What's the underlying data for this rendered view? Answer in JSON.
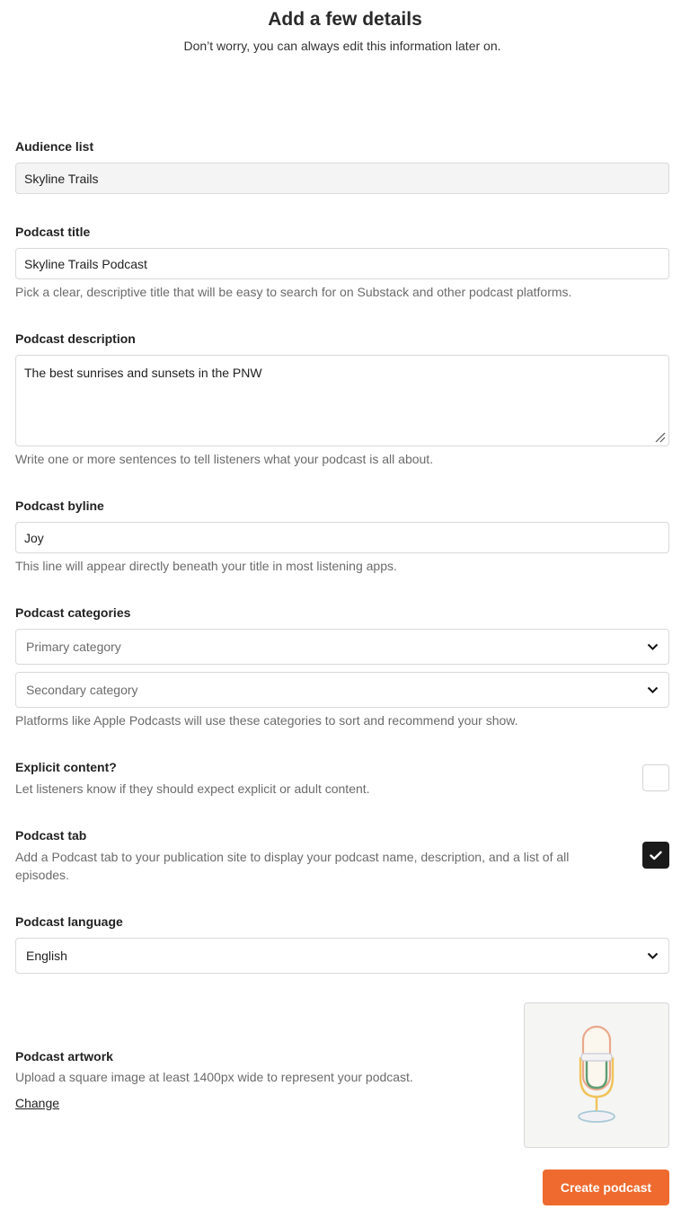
{
  "header": {
    "title": "Add a few details",
    "subtitle": "Don’t worry, you can always edit this information later on."
  },
  "audience": {
    "label": "Audience list",
    "value": "Skyline Trails"
  },
  "title_field": {
    "label": "Podcast title",
    "value": "Skyline Trails Podcast",
    "help": "Pick a clear, descriptive title that will be easy to search for on Substack and other podcast platforms."
  },
  "description": {
    "label": "Podcast description",
    "value": "The best sunrises and sunsets in the PNW",
    "help": "Write one or more sentences to tell listeners what your podcast is all about."
  },
  "byline": {
    "label": "Podcast byline",
    "value": "Joy",
    "help": "This line will appear directly beneath your title in most listening apps."
  },
  "categories": {
    "label": "Podcast categories",
    "primary_placeholder": "Primary category",
    "secondary_placeholder": "Secondary category",
    "help": "Platforms like Apple Podcasts will use these categories to sort and recommend your show."
  },
  "explicit": {
    "label": "Explicit content?",
    "help": "Let listeners know if they should expect explicit or adult content.",
    "checked": false
  },
  "podcast_tab": {
    "label": "Podcast tab",
    "help": "Add a Podcast tab to your publication site to display your podcast name, description, and a list of all episodes.",
    "checked": true
  },
  "language": {
    "label": "Podcast language",
    "value": "English"
  },
  "artwork": {
    "label": "Podcast artwork",
    "help": "Upload a square image at least 1400px wide to represent your podcast.",
    "change_label": "Change",
    "icon": "microphone-icon"
  },
  "actions": {
    "create_label": "Create podcast"
  },
  "colors": {
    "accent": "#ee6a2e",
    "checkbox_on": "#1a1a1a",
    "muted_text": "#6b6b6b",
    "border": "#d9d9d9"
  }
}
